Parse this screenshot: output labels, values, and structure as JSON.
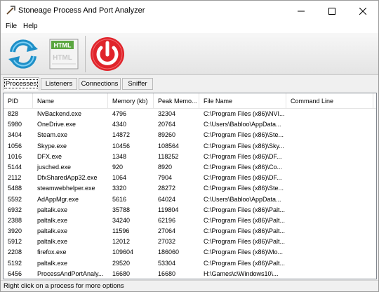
{
  "window": {
    "title": "Stoneage Process And Port Analyzer"
  },
  "menu": {
    "file": "File",
    "help": "Help"
  },
  "toolbar": {
    "refresh_icon": "refresh-icon",
    "html_icon": "html-export-icon",
    "html_label": "HTML",
    "power_icon": "power-icon"
  },
  "tabs": [
    {
      "label": "Processes",
      "active": true
    },
    {
      "label": "Listeners",
      "active": false
    },
    {
      "label": "Connections",
      "active": false
    },
    {
      "label": "Sniffer",
      "active": false
    }
  ],
  "table": {
    "columns": [
      "PID",
      "Name",
      "Memory (kb)",
      "Peak Memo...",
      "File Name",
      "Command Line"
    ],
    "rows": [
      [
        "828",
        "NvBackend.exe",
        "4796",
        "32304",
        "C:\\Program Files (x86)\\NVI...",
        ""
      ],
      [
        "5980",
        "OneDrive.exe",
        "4340",
        "20764",
        "C:\\Users\\Babloo\\AppData...",
        ""
      ],
      [
        "3404",
        "Steam.exe",
        "14872",
        "89260",
        "C:\\Program Files (x86)\\Ste...",
        ""
      ],
      [
        "1056",
        "Skype.exe",
        "10456",
        "108564",
        "C:\\Program Files (x86)\\Sky...",
        ""
      ],
      [
        "1016",
        "DFX.exe",
        "1348",
        "118252",
        "C:\\Program Files (x86)\\DF...",
        ""
      ],
      [
        "5144",
        "jusched.exe",
        "920",
        "8920",
        "C:\\Program Files (x86)\\Co...",
        ""
      ],
      [
        "2112",
        "DfxSharedApp32.exe",
        "1064",
        "7904",
        "C:\\Program Files (x86)\\DF...",
        ""
      ],
      [
        "5488",
        "steamwebhelper.exe",
        "3320",
        "28272",
        "C:\\Program Files (x86)\\Ste...",
        ""
      ],
      [
        "5592",
        "AdAppMgr.exe",
        "5616",
        "64024",
        "C:\\Users\\Babloo\\AppData...",
        ""
      ],
      [
        "6932",
        "paltalk.exe",
        "35788",
        "119804",
        "C:\\Program Files (x86)\\Palt...",
        ""
      ],
      [
        "2388",
        "paltalk.exe",
        "34240",
        "62196",
        "C:\\Program Files (x86)\\Palt...",
        ""
      ],
      [
        "3920",
        "paltalk.exe",
        "11596",
        "27064",
        "C:\\Program Files (x86)\\Palt...",
        ""
      ],
      [
        "5912",
        "paltalk.exe",
        "12012",
        "27032",
        "C:\\Program Files (x86)\\Palt...",
        ""
      ],
      [
        "2208",
        "firefox.exe",
        "109604",
        "186060",
        "C:\\Program Files (x86)\\Mo...",
        ""
      ],
      [
        "5192",
        "paltalk.exe",
        "29520",
        "53304",
        "C:\\Program Files (x86)\\Palt...",
        ""
      ],
      [
        "6456",
        "ProcessAndPortAnaly...",
        "16680",
        "16680",
        "H:\\Games\\c\\Windows10\\...",
        ""
      ]
    ]
  },
  "status": {
    "text": "Right click on a process for more options"
  },
  "colors": {
    "refresh": "#1e8fc7",
    "power": "#e0242b",
    "html_badge": "#5aa640"
  }
}
